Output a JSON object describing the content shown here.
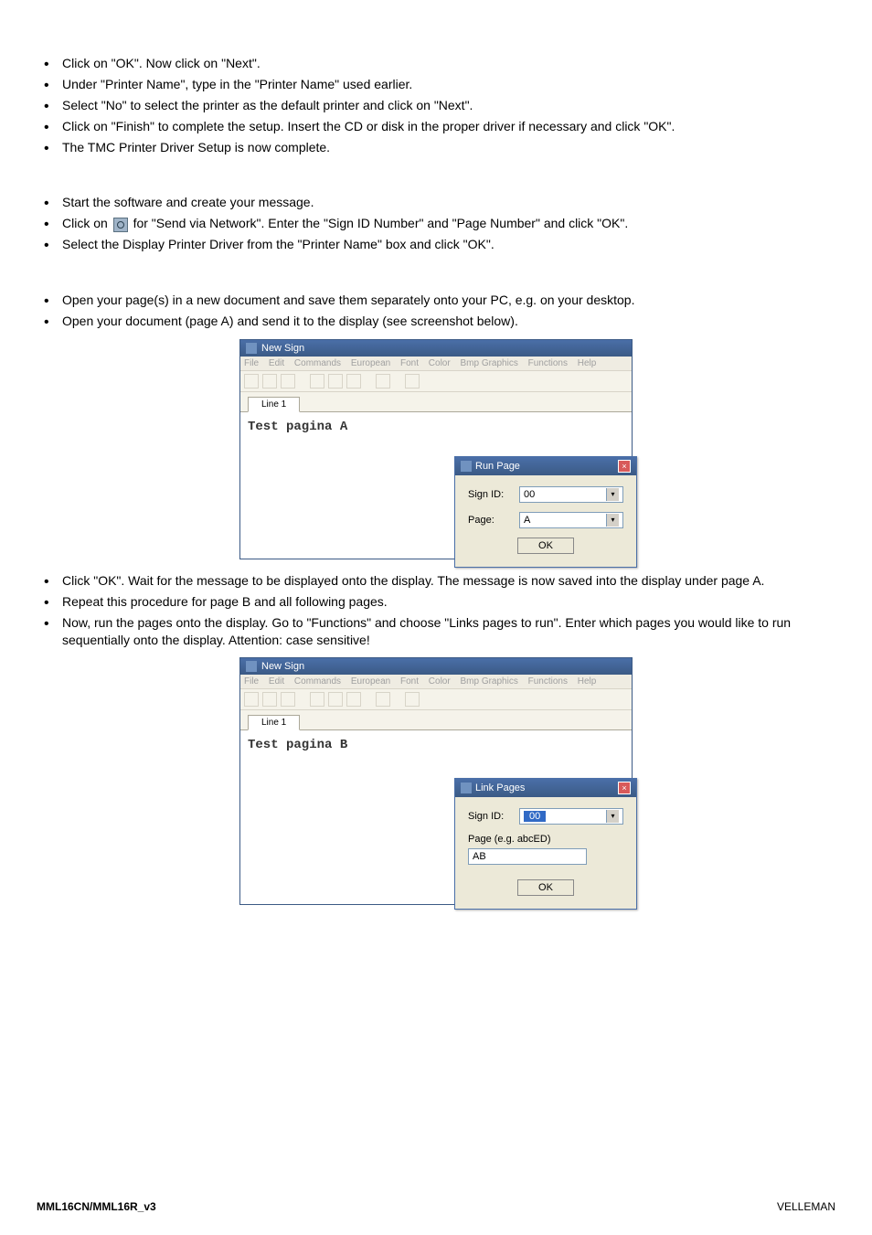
{
  "bullets_1": [
    "Click on \"OK\". Now click on \"Next\".",
    "Under \"Printer Name\", type in the \"Printer Name\" used earlier.",
    "Select \"No\" to select the printer as the default printer and click on \"Next\".",
    "Click on \"Finish\" to complete the setup. Insert the CD or disk in the proper driver if necessary and click \"OK\".",
    "The TMC Printer Driver Setup is now complete."
  ],
  "bullets_2": {
    "item0": "Start the software and create your message.",
    "item1_pre": "Click on ",
    "item1_post": " for \"Send via Network\". Enter the \"Sign ID Number\" and \"Page Number\" and click \"OK\".",
    "item2": "Select the Display Printer Driver from the \"Printer Name\" box and click \"OK\"."
  },
  "bullets_3": [
    "Open your page(s) in a new document and save them separately onto your PC, e.g. on your desktop.",
    "Open your document (page A) and send it to the display (see screenshot below)."
  ],
  "bullets_4": [
    "Click \"OK\". Wait for the message to be displayed onto the display. The message is now saved into the display under page A.",
    "Repeat this procedure for page B and all following pages.",
    "Now, run the pages onto the display. Go to \"Functions\" and choose \"Links pages to run\". Enter which pages you would like to run sequentially onto the display. Attention: case sensitive!"
  ],
  "app1": {
    "title": "New Sign",
    "menu": [
      "File",
      "Edit",
      "Commands",
      "European",
      "Font",
      "Color",
      "Bmp Graphics",
      "Functions",
      "Help"
    ],
    "tab": "Line 1",
    "canvas_text": "Test pagina A",
    "dialog": {
      "title": "Run Page",
      "label_sign": "Sign ID:",
      "value_sign": "00",
      "label_page": "Page:",
      "value_page": "A",
      "ok": "OK"
    }
  },
  "app2": {
    "title": "New Sign",
    "menu": [
      "File",
      "Edit",
      "Commands",
      "European",
      "Font",
      "Color",
      "Bmp Graphics",
      "Functions",
      "Help"
    ],
    "tab": "Line 1",
    "canvas_text": "Test pagina B",
    "dialog": {
      "title": "Link Pages",
      "label_sign": "Sign ID:",
      "value_sign": "00",
      "label_page": "Page (e.g. abcED)",
      "value_page": "AB",
      "ok": "OK"
    }
  },
  "footer": {
    "left": "MML16CN/MML16R_v3",
    "right": "VELLEMAN"
  }
}
